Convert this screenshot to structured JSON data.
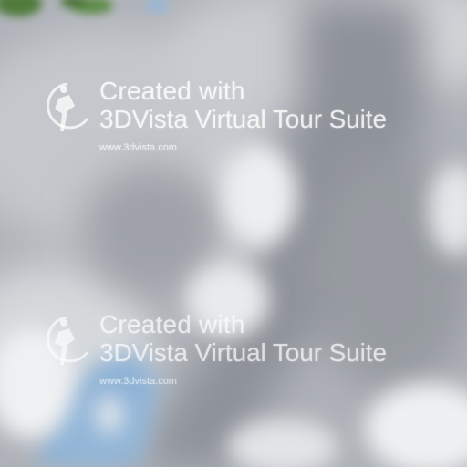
{
  "image": {
    "description_alt": "",
    "colors": {
      "sky_blue": "#8fb3d8",
      "cloud_gray": "#9ea2a9",
      "cloud_white": "#eef0f2",
      "foliage_green": "#4f7a3a"
    }
  },
  "watermarks": [
    {
      "line1": "Created with",
      "line2": "3DVista Virtual Tour Suite",
      "url": "www.3dvista.com",
      "logo_icon": "3dvista-logo-icon"
    },
    {
      "line1": "Created with",
      "line2": "3DVista Virtual Tour Suite",
      "url": "www.3dvista.com",
      "logo_icon": "3dvista-logo-icon"
    }
  ]
}
